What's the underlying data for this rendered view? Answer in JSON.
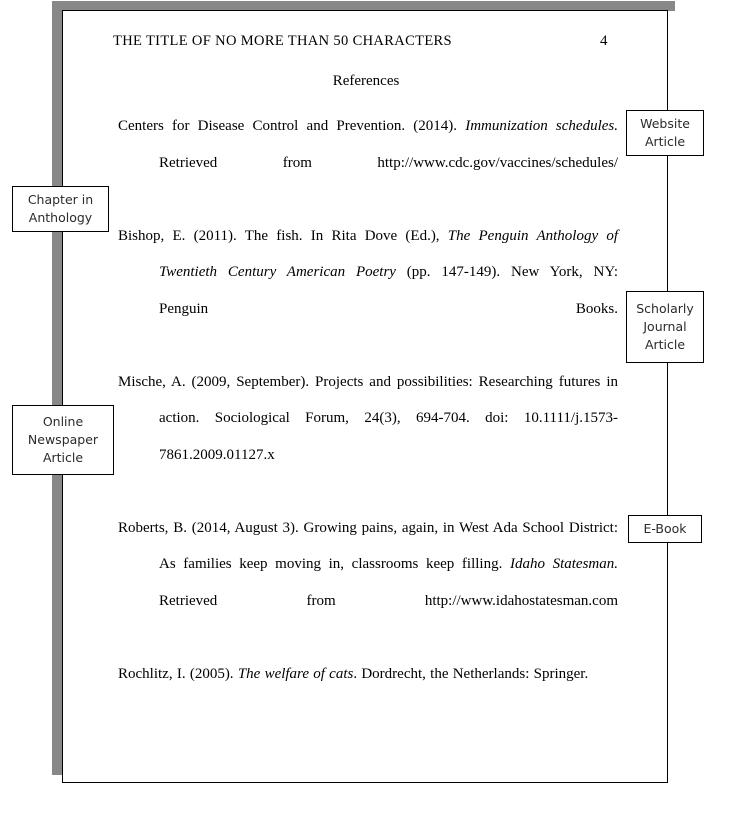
{
  "document": {
    "running_head": "THE  TITLE  OF NO MORE  THAN  50 CHARACTERS",
    "page_number": "4",
    "section_heading": "References"
  },
  "references": [
    {
      "id": "cdc-website",
      "parts": [
        {
          "text": "Centers for Disease Control and Prevention.  (2014). ",
          "style": "normal"
        },
        {
          "text": "Immunization schedules.",
          "style": "italic"
        },
        {
          "text": " Retrieved  from http://www.cdc.gov/vaccines/schedules/",
          "style": "normal"
        }
      ],
      "plain": "Centers for Disease Control and Prevention.  (2014). Immunization schedules. Retrieved  from http://www.cdc.gov/vaccines/schedules/"
    },
    {
      "id": "bishop-anthology",
      "parts": [
        {
          "text": "Bishop,  E.  (2011).  The  fish.   In Rita  Dove  (Ed.),  ",
          "style": "normal"
        },
        {
          "text": "The Penguin Anthology of Twentieth Century American Poetry",
          "style": "italic"
        },
        {
          "text": "  (pp.  147-149).  New  York,  NY:  Penguin  Books.",
          "style": "normal"
        }
      ],
      "plain": "Bishop,  E.  (2011).  The  fish.   In Rita  Dove  (Ed.),  The Penguin Anthology of Twentieth Century American Poetry  (pp.  147-149).  New  York,  NY:  Penguin  Books."
    },
    {
      "id": "mische-journal",
      "parts": [
        {
          "text": "Mische,  A.  (2009,  September).   Projects  and  possibilities:   Researching  futures  in action.   Sociological   Forum,  24(3),  694-704.  doi:  10.1111/j.1573-7861.2009.01127.x",
          "style": "normal"
        }
      ],
      "plain": "Mische,  A.  (2009,  September).   Projects  and  possibilities:   Researching  futures  in action.   Sociological   Forum,  24(3),  694-704.  doi:  10.1111/j.1573-7861.2009.01127.x"
    },
    {
      "id": "roberts-newspaper",
      "parts": [
        {
          "text": "Roberts,  B.  (2014,  August  3).  Growing  pains,  again,  in West Ada School  District:   As families  keep moving  in,  classrooms  keep filling.  ",
          "style": "normal"
        },
        {
          "text": "Idaho Statesman.",
          "style": "italic"
        },
        {
          "text": " Retrieved  from  http://www.idahostatesman.com",
          "style": "normal"
        }
      ],
      "plain": "Roberts,  B.  (2014,  August  3).  Growing  pains,  again,  in West Ada School  District:   As families  keep moving  in,  classrooms  keep filling.  Idaho Statesman. Retrieved  from  http://www.idahostatesman.com"
    },
    {
      "id": "rochlitz-ebook",
      "parts": [
        {
          "text": "Rochlitz,  I.  (2005).  ",
          "style": "normal"
        },
        {
          "text": "The welfare of cats",
          "style": "italic"
        },
        {
          "text": ". Dordrecht,  the  Netherlands:   Springer.",
          "style": "normal"
        }
      ],
      "plain": "Rochlitz,  I.  (2005).  The welfare of cats. Dordrecht,  the  Netherlands:   Springer."
    }
  ],
  "annotations": {
    "website_article": {
      "lines": [
        "Website",
        "Article"
      ]
    },
    "scholarly_journal_article": {
      "lines": [
        "Scholarly",
        "Journal",
        "Article"
      ]
    },
    "ebook": {
      "lines": [
        "E-Book"
      ]
    },
    "chapter_in_anthology": {
      "lines": [
        "Chapter in",
        "Anthology"
      ]
    },
    "online_newspaper_article": {
      "lines": [
        "Online",
        "Newspaper",
        "Article"
      ]
    }
  },
  "colors": {
    "page_border": "#000000",
    "page_background": "#ffffff",
    "shadow": "#888888",
    "text": "#000000",
    "callout_text": "#2b2b2b",
    "callout_border": "#000000"
  }
}
